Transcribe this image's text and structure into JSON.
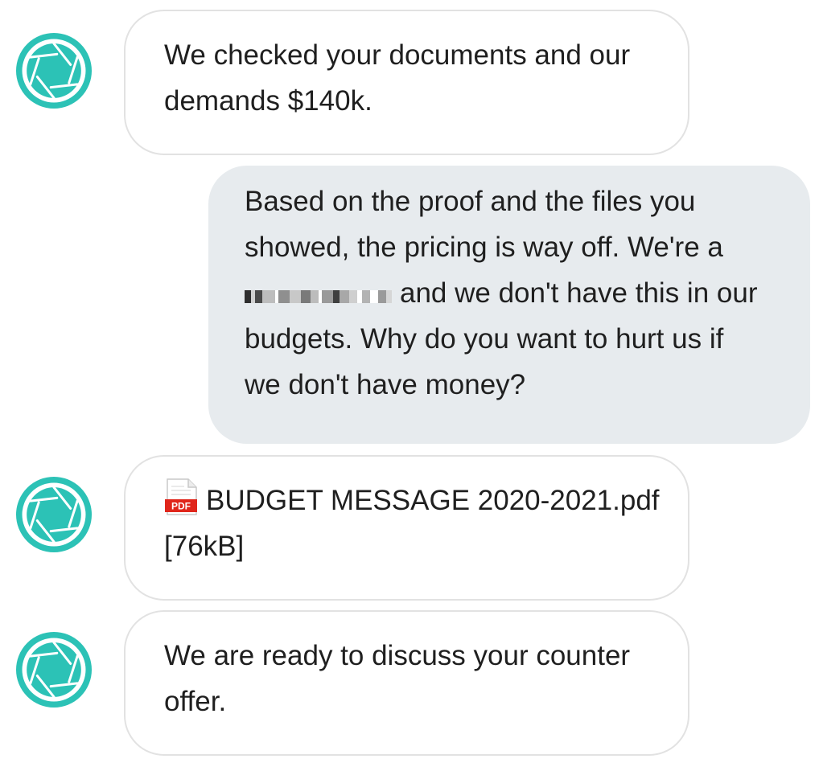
{
  "messages": [
    {
      "sender": "agent",
      "avatar_icon": "aperture-icon",
      "lines": [
        "We checked your documents and our",
        "demands $140k."
      ]
    },
    {
      "sender": "user",
      "lines": [
        "Based on the proof and the files you",
        "showed, the pricing is way off. We're a",
        "and we don't have this in our",
        "budgets. Why do you want to hurt us if",
        "we don't have money?"
      ]
    },
    {
      "sender": "agent",
      "avatar_icon": "aperture-icon",
      "attachment": {
        "icon": "pdf-file-icon",
        "icon_label": "PDF",
        "filename": "BUDGET MESSAGE 2020-2021.pdf",
        "size": "[76kB]"
      }
    },
    {
      "sender": "agent",
      "avatar_icon": "aperture-icon",
      "lines": [
        "We are ready to discuss your counter",
        "offer."
      ]
    }
  ],
  "colors": {
    "avatar": "#2cc2b6",
    "user_bubble": "#e7ebee",
    "agent_bubble_border": "#e2e2e2",
    "pdf_red": "#e0261b"
  }
}
